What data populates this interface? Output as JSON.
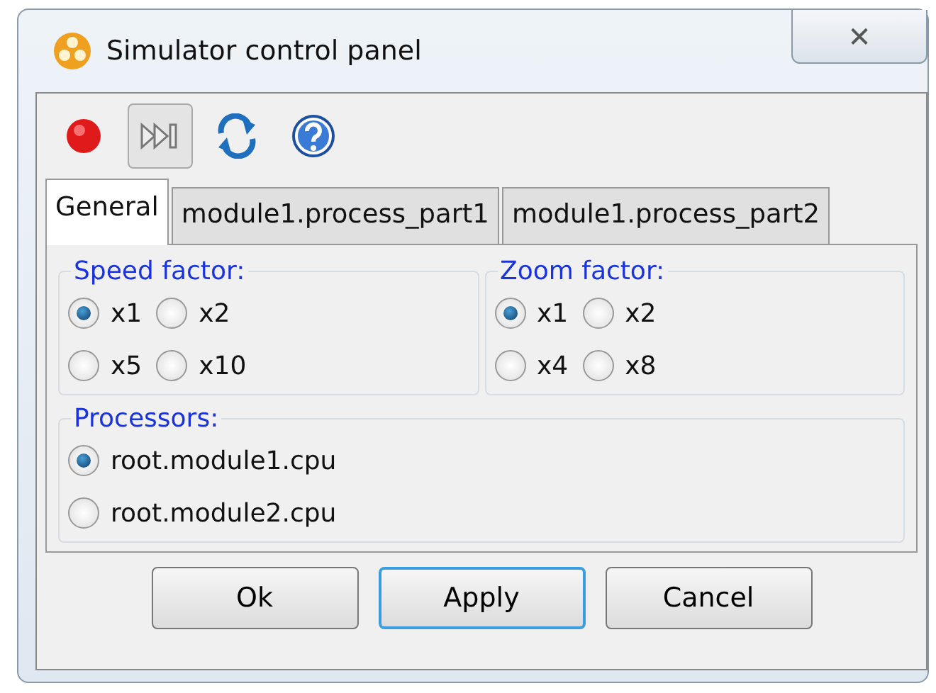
{
  "window": {
    "title": "Simulator control panel",
    "close_label": "✕"
  },
  "toolbar": [
    {
      "kind": "record",
      "pressed": false
    },
    {
      "kind": "step",
      "pressed": true
    },
    {
      "kind": "refresh",
      "pressed": false
    },
    {
      "kind": "help",
      "pressed": false
    }
  ],
  "tabs": [
    {
      "label": "General",
      "selected": true
    },
    {
      "label": "module1.process_part1",
      "selected": false
    },
    {
      "label": "module1.process_part2",
      "selected": false
    }
  ],
  "groups": [
    {
      "title": "Speed factor:",
      "kind": "grid",
      "options": [
        {
          "label": "x1",
          "selected": true
        },
        {
          "label": "x2",
          "selected": false
        },
        {
          "label": "x5",
          "selected": false
        },
        {
          "label": "x10",
          "selected": false
        }
      ]
    },
    {
      "title": "Zoom factor:",
      "kind": "grid",
      "options": [
        {
          "label": "x1",
          "selected": true
        },
        {
          "label": "x2",
          "selected": false
        },
        {
          "label": "x4",
          "selected": false
        },
        {
          "label": "x8",
          "selected": false
        }
      ]
    },
    {
      "title": "Processors:",
      "kind": "list",
      "options": [
        {
          "label": "root.module1.cpu",
          "selected": true
        },
        {
          "label": "root.module2.cpu",
          "selected": false
        }
      ]
    }
  ],
  "buttons": [
    {
      "label": "Ok",
      "default": false
    },
    {
      "label": "Apply",
      "default": true
    },
    {
      "label": "Cancel",
      "default": false
    }
  ]
}
